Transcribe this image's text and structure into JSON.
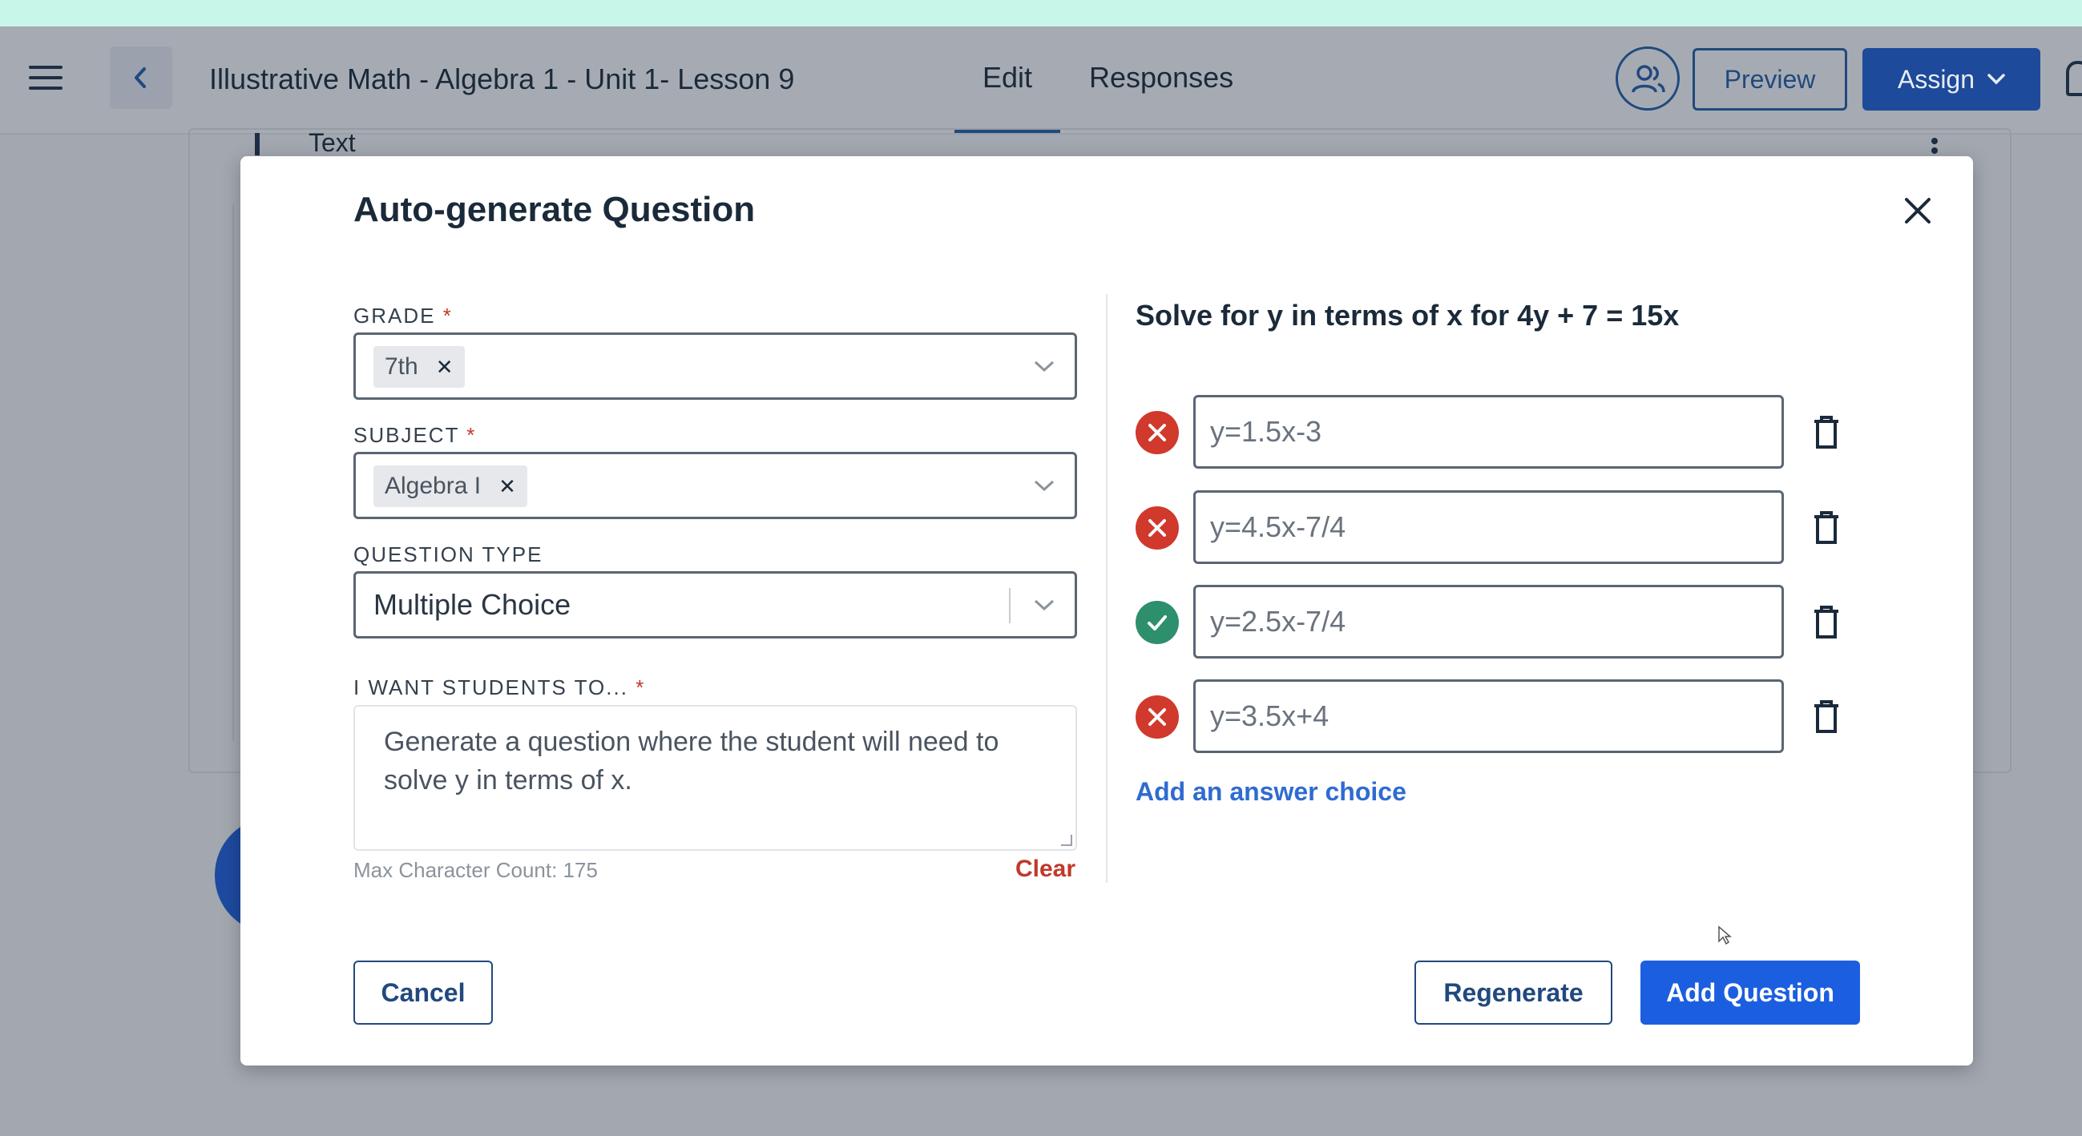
{
  "header": {
    "title": "Illustrative Math - Algebra 1 - Unit 1- Lesson 9",
    "tabs": [
      {
        "label": "Edit",
        "active": true
      },
      {
        "label": "Responses",
        "active": false
      }
    ],
    "preview_label": "Preview",
    "assign_label": "Assign"
  },
  "background": {
    "section_label": "Text"
  },
  "modal": {
    "title": "Auto-generate Question",
    "grade": {
      "label": "GRADE",
      "required_mark": "*",
      "selected": "7th"
    },
    "subject": {
      "label": "SUBJECT",
      "required_mark": "*",
      "selected": "Algebra I"
    },
    "question_type": {
      "label": "QUESTION TYPE",
      "value": "Multiple Choice"
    },
    "students_to": {
      "label": "I WANT STUDENTS TO...",
      "required_mark": "*",
      "value": "Generate a question where the student will need to solve y in terms of x.",
      "max_count_text": "Max Character Count: 175",
      "clear_label": "Clear"
    },
    "question_text": "Solve for y in terms of x for 4y + 7 = 15x",
    "answers": [
      {
        "value": "y=1.5x-3",
        "correct": false
      },
      {
        "value": "y=4.5x-7/4",
        "correct": false
      },
      {
        "value": "y=2.5x-7/4",
        "correct": true
      },
      {
        "value": "y=3.5x+4",
        "correct": false
      }
    ],
    "add_choice_label": "Add an answer choice",
    "cancel_label": "Cancel",
    "regenerate_label": "Regenerate",
    "add_question_label": "Add Question"
  },
  "colors": {
    "primary": "#1b5fe0",
    "navy": "#21497e",
    "wrong": "#d0392c",
    "correct": "#2e8f6d",
    "required": "#c0392b"
  }
}
